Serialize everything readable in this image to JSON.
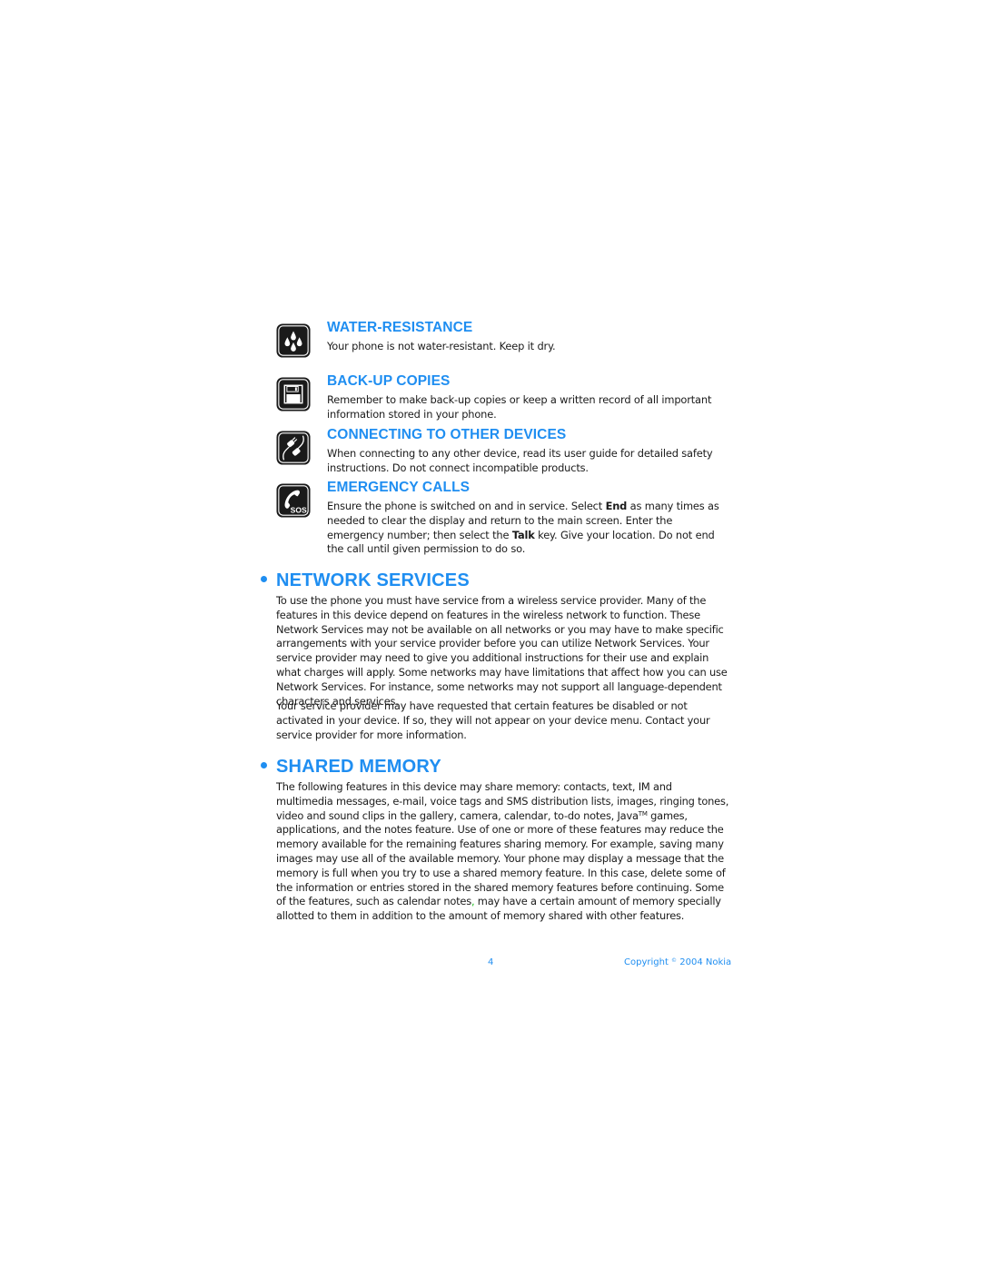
{
  "colors": {
    "accent": "#1f8ef1",
    "text": "#1a1a1a",
    "icon_bg": "#1a1a1a",
    "highlight": "#22c022"
  },
  "safety_items": [
    {
      "icon": "water-drops-icon",
      "title": "WATER-RESISTANCE",
      "text": "Your phone is not water-resistant. Keep it dry."
    },
    {
      "icon": "floppy-disk-icon",
      "title": "BACK-UP COPIES",
      "text": "Remember to make back-up copies or keep a written record of all important information stored in your phone."
    },
    {
      "icon": "plug-connector-icon",
      "title": "CONNECTING TO OTHER DEVICES",
      "text": "When connecting to any other device, read its user guide for detailed safety instructions. Do not connect incompatible products."
    },
    {
      "icon": "phone-sos-icon",
      "title": "EMERGENCY CALLS",
      "text_parts": [
        "Ensure the phone is switched on and in service. Select ",
        "End",
        " as many times as needed to clear the display and return to the main screen. Enter the emergency number; then select the ",
        "Talk",
        " key. Give your location. Do not end the call until given permission to do so."
      ]
    }
  ],
  "network_services": {
    "title": "NETWORK SERVICES",
    "paragraphs": [
      "To use the phone you must have service from a wireless service provider. Many of the features in this device depend on features in the wireless network to function. These Network Services may not be available on all networks or you may have to make specific arrangements with your service provider before you can utilize Network Services. Your service provider may need to give you additional instructions for their use and explain what charges will apply. Some networks may have limitations that affect how you can use Network Services. For instance, some networks may not support all language-dependent characters and services.",
      "Your service provider may have requested that certain features be disabled or not activated in your device. If so, they will not appear on your device menu. Contact your service provider for more information."
    ]
  },
  "shared_memory": {
    "title": "SHARED MEMORY",
    "text_parts": [
      "The following features in this device may share memory: contacts, text, IM and multimedia messages, e-mail, voice tags and SMS distribution lists, images, ringing tones, video and sound clips in the gallery, camera, calendar, to-do notes, Java",
      "TM",
      " games, applications, and the notes feature. Use of one or more of these features may reduce the memory available for the remaining features sharing memory. For example, saving many images may use all of the available memory. Your phone may display a message that the memory is full when you try to use a shared memory feature. In this case, delete some of the information or entries stored in the shared memory features before continuing. Some of the features, such as calendar notes",
      ",",
      " may have a certain amount of memory specially allotted to them in addition to the amount of memory shared with other features."
    ]
  },
  "footer": {
    "page_number": "4",
    "copyright_prefix": "Copyright ",
    "copyright_symbol": "©",
    "copyright_suffix": " 2004 Nokia"
  }
}
